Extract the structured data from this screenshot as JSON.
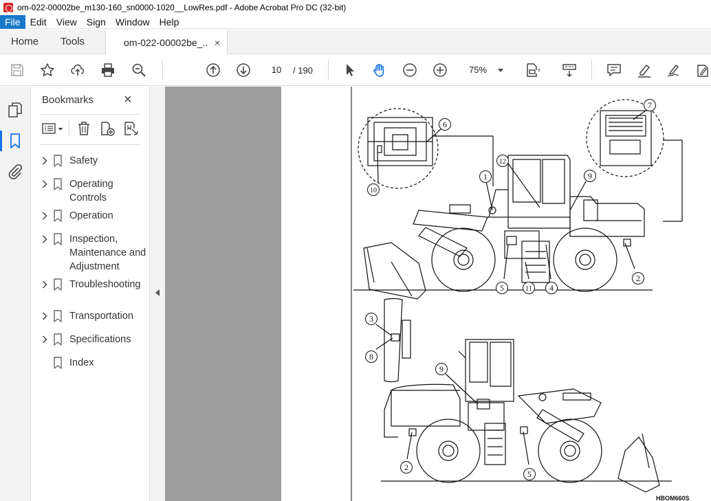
{
  "window": {
    "title": "om-022-00002be_m130-160_sn0000-1020__LowRes.pdf - Adobe Acrobat Pro DC (32-bit)"
  },
  "menu": [
    "File",
    "Edit",
    "View",
    "Sign",
    "Window",
    "Help"
  ],
  "tabs": {
    "home": "Home",
    "tools": "Tools",
    "document": "om-022-00002be_...",
    "close": "×"
  },
  "toolbar": {
    "page_current": "10",
    "page_total": "/ 190",
    "zoom": "75%"
  },
  "bookmarks": {
    "title": "Bookmarks",
    "close": "×",
    "items": [
      {
        "label": "Safety",
        "expandable": true
      },
      {
        "label": "Operating Controls",
        "expandable": true
      },
      {
        "label": "Operation",
        "expandable": true
      },
      {
        "label": "Inspection, Maintenance and Adjustment",
        "expandable": true
      },
      {
        "label": "Troubleshooting",
        "expandable": true
      },
      {
        "label": "Transportation",
        "expandable": true
      },
      {
        "label": "Specifications",
        "expandable": true
      },
      {
        "label": "Index",
        "expandable": false
      }
    ]
  },
  "document": {
    "callouts": [
      "1",
      "2",
      "3",
      "4",
      "5",
      "6",
      "7",
      "8",
      "9",
      "10",
      "11",
      "12"
    ],
    "figure_code": "HBOM660S"
  },
  "colors": {
    "accent": "#1473e6",
    "menu_active": "#1979ca",
    "doc_background": "#9d9d9d",
    "app_icon": "#d7262b"
  }
}
